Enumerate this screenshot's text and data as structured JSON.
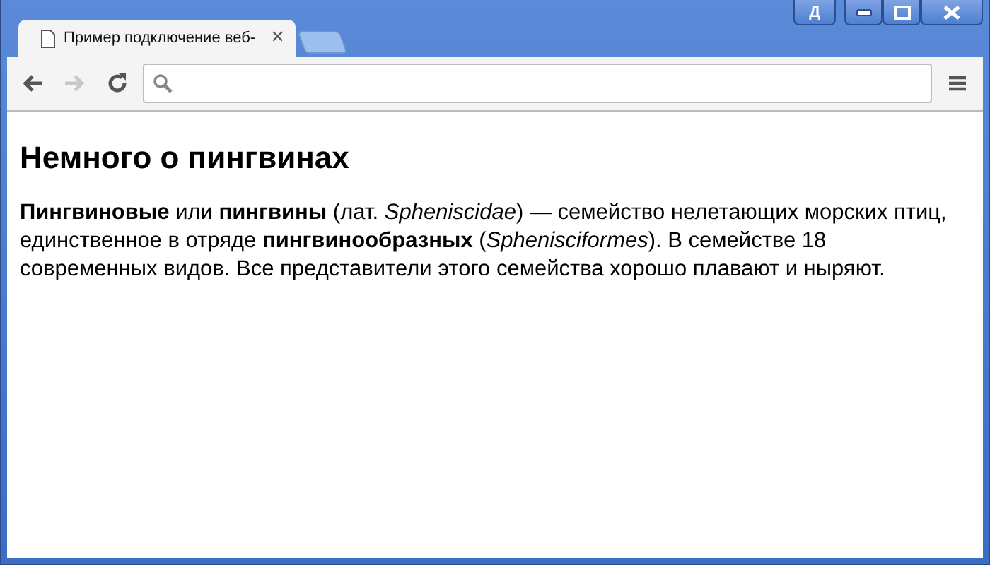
{
  "window": {
    "language_indicator": "Д"
  },
  "tabs": [
    {
      "title": "Пример подключение веб-",
      "close": "×",
      "selected": true
    }
  ],
  "toolbar": {
    "back_disabled": false,
    "forward_disabled": true
  },
  "page": {
    "heading": "Немного о пингвинах",
    "paragraph": "**Пингвиновые** или **пингвины** (лат. *Spheniscidae*) — семейство нелетающих морских птиц, единственное в отряде **пингвинообразных** (*Sphenisciformes*). В семействе 18 современных видов. Все представители этого семейства хорошо плавают и ныряют."
  }
}
